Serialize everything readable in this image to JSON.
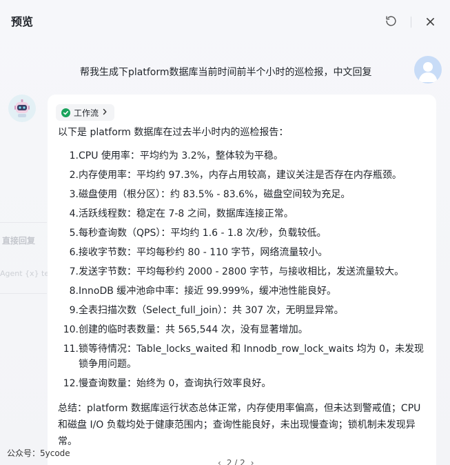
{
  "header": {
    "title": "预览"
  },
  "sidebar_faded": {
    "label_1": "直接回复",
    "label_2": "Agent   {x} te"
  },
  "conversation": {
    "user_message": "帮我生成下platform数据库当前时间前半个小时的巡检报，中文回复",
    "workflow_chip": "工作流",
    "intro": "以下是 platform 数据库在过去半小时内的巡检报告：",
    "items": [
      {
        "num": "1.",
        "text": "CPU 使用率：平均约为 3.2%，整体较为平稳。"
      },
      {
        "num": "2.",
        "text": "内存使用率：平均约 97.3%，内存占用较高，建议关注是否存在内存瓶颈。"
      },
      {
        "num": "3.",
        "text": "磁盘使用（根分区）：约 83.5% - 83.6%，磁盘空间较为充足。"
      },
      {
        "num": "4.",
        "text": "活跃线程数：稳定在 7-8 之间，数据库连接正常。"
      },
      {
        "num": "5.",
        "text": "每秒查询数（QPS）：平均约 1.6 - 1.8 次/秒，负载较低。"
      },
      {
        "num": "6.",
        "text": "接收字节数：平均每秒约 80 - 110 字节，网络流量较小。"
      },
      {
        "num": "7.",
        "text": "发送字节数：平均每秒约 2000 - 2800 字节，与接收相比，发送流量较大。"
      },
      {
        "num": "8.",
        "text": "InnoDB 缓冲池命中率：接近 99.999%，缓冲池性能良好。"
      },
      {
        "num": "9.",
        "text": "全表扫描次数（Select_full_join）：共 307 次，无明显异常。"
      },
      {
        "num": "10.",
        "text": "创建的临时表数量：共 565,544 次，没有显著增加。"
      },
      {
        "num": "11.",
        "text": "锁等待情况：Table_locks_waited 和 Innodb_row_lock_waits 均为 0，未发现锁争用问题。"
      },
      {
        "num": "12.",
        "text": "慢查询数量：始终为 0，查询执行效率良好。"
      }
    ],
    "summary": "总结：platform 数据库运行状态总体正常，内存使用率偏高，但未达到警戒值；CPU 和磁盘 I/O 负载均处于健康范围内；查询性能良好，未出现慢查询；锁机制未发现异常。",
    "pager": "2 / 2"
  },
  "watermark": "公众号：5ycode",
  "colors": {
    "accent_green": "#1aa35c",
    "user_avatar_bg": "#c8dcf7"
  }
}
